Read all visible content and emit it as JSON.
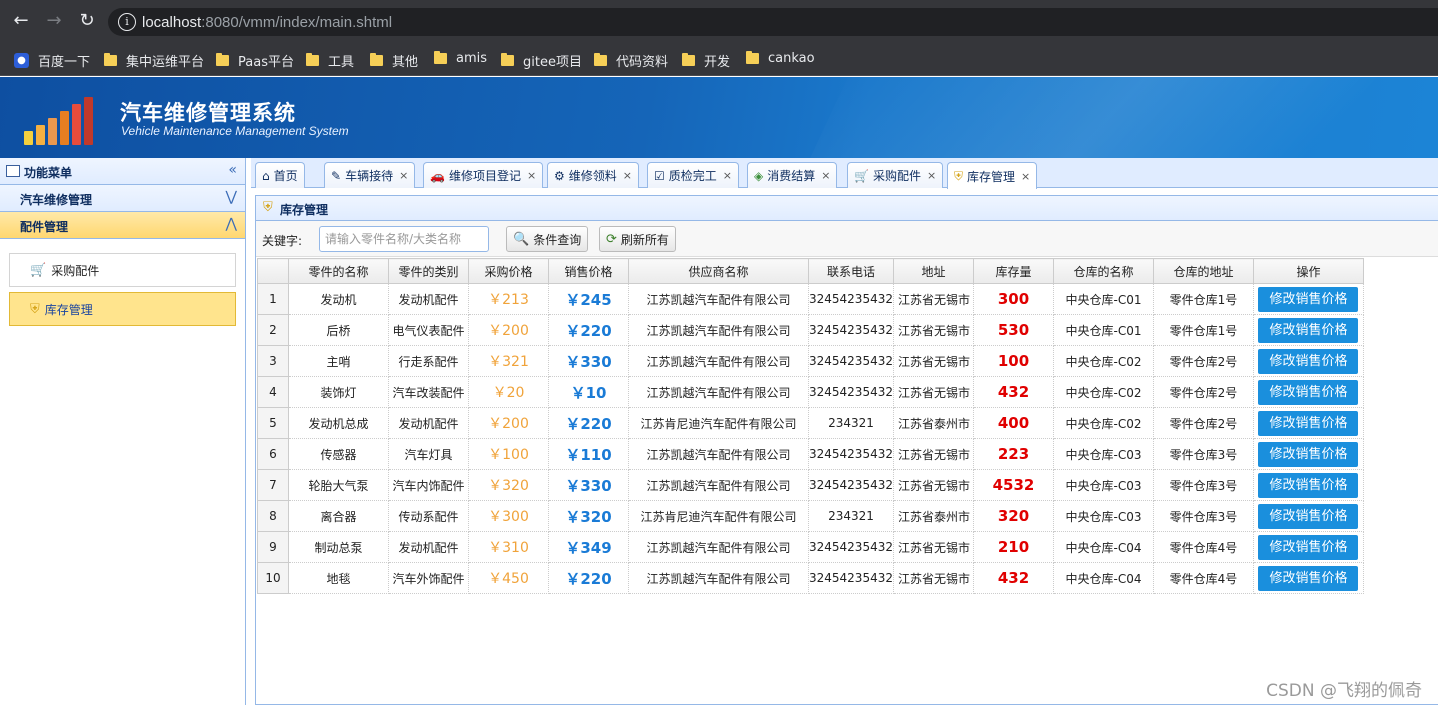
{
  "browser": {
    "url_host": "localhost",
    "url_rest": ":8080/vmm/index/main.shtml",
    "bookmarks": [
      {
        "label": "百度一下",
        "icon": "baidu-icon"
      },
      {
        "label": "集中运维平台",
        "icon": "folder-icon"
      },
      {
        "label": "Paas平台",
        "icon": "folder-icon"
      },
      {
        "label": "工具",
        "icon": "folder-icon"
      },
      {
        "label": "其他",
        "icon": "folder-icon"
      },
      {
        "label": "amis",
        "icon": "folder-icon"
      },
      {
        "label": "gitee项目",
        "icon": "folder-icon"
      },
      {
        "label": "代码资料",
        "icon": "folder-icon"
      },
      {
        "label": "开发",
        "icon": "folder-icon"
      },
      {
        "label": "cankao",
        "icon": "folder-icon"
      }
    ]
  },
  "app": {
    "title": "汽车维修管理系统",
    "subtitle": "Vehicle Maintenance Management System"
  },
  "menu": {
    "title": "功能菜单",
    "sections": [
      {
        "label": "汽车维修管理"
      },
      {
        "label": "配件管理"
      }
    ],
    "items": [
      {
        "label": "采购配件",
        "icon": "cart-icon"
      },
      {
        "label": "库存管理",
        "icon": "shield-icon"
      }
    ]
  },
  "tabs": [
    {
      "label": "首页",
      "icon": "home-icon"
    },
    {
      "label": "车辆接待",
      "icon": "form-icon"
    },
    {
      "label": "维修项目登记",
      "icon": "car-icon"
    },
    {
      "label": "维修领料",
      "icon": "parts-icon"
    },
    {
      "label": "质检完工",
      "icon": "check-icon"
    },
    {
      "label": "消费结算",
      "icon": "money-icon"
    },
    {
      "label": "采购配件",
      "icon": "cart-icon"
    },
    {
      "label": "库存管理",
      "icon": "shield-icon"
    }
  ],
  "content": {
    "title": "库存管理",
    "keyword_label": "关键字:",
    "keyword_placeholder": "请输入零件名称/大类名称",
    "search_button": "条件查询",
    "refresh_button": "刷新所有"
  },
  "grid": {
    "columns": [
      "零件的名称",
      "零件的类别",
      "采购价格",
      "销售价格",
      "供应商名称",
      "联系电话",
      "地址",
      "库存量",
      "仓库的名称",
      "仓库的地址",
      "操作"
    ],
    "action_label": "修改销售价格",
    "rows": [
      {
        "no": "1",
        "name": "发动机",
        "category": "发动机配件",
        "purchase": "￥213",
        "sale": "￥245",
        "supplier": "江苏凯越汽车配件有限公司",
        "phone": "32454235432",
        "address": "江苏省无锡市",
        "stock": "300",
        "warehouse": "中央仓库-C01",
        "wh_addr": "零件仓库1号"
      },
      {
        "no": "2",
        "name": "后桥",
        "category": "电气仪表配件",
        "purchase": "￥200",
        "sale": "￥220",
        "supplier": "江苏凯越汽车配件有限公司",
        "phone": "32454235432",
        "address": "江苏省无锡市",
        "stock": "530",
        "warehouse": "中央仓库-C01",
        "wh_addr": "零件仓库1号"
      },
      {
        "no": "3",
        "name": "主哨",
        "category": "行走系配件",
        "purchase": "￥321",
        "sale": "￥330",
        "supplier": "江苏凯越汽车配件有限公司",
        "phone": "32454235432",
        "address": "江苏省无锡市",
        "stock": "100",
        "warehouse": "中央仓库-C02",
        "wh_addr": "零件仓库2号"
      },
      {
        "no": "4",
        "name": "装饰灯",
        "category": "汽车改装配件",
        "purchase": "￥20",
        "sale": "￥10",
        "supplier": "江苏凯越汽车配件有限公司",
        "phone": "32454235432",
        "address": "江苏省无锡市",
        "stock": "432",
        "warehouse": "中央仓库-C02",
        "wh_addr": "零件仓库2号"
      },
      {
        "no": "5",
        "name": "发动机总成",
        "category": "发动机配件",
        "purchase": "￥200",
        "sale": "￥220",
        "supplier": "江苏肯尼迪汽车配件有限公司",
        "phone": "234321",
        "address": "江苏省泰州市",
        "stock": "400",
        "warehouse": "中央仓库-C02",
        "wh_addr": "零件仓库2号"
      },
      {
        "no": "6",
        "name": "传感器",
        "category": "汽车灯具",
        "purchase": "￥100",
        "sale": "￥110",
        "supplier": "江苏凯越汽车配件有限公司",
        "phone": "32454235432",
        "address": "江苏省无锡市",
        "stock": "223",
        "warehouse": "中央仓库-C03",
        "wh_addr": "零件仓库3号"
      },
      {
        "no": "7",
        "name": "轮胎大气泵",
        "category": "汽车内饰配件",
        "purchase": "￥320",
        "sale": "￥330",
        "supplier": "江苏凯越汽车配件有限公司",
        "phone": "32454235432",
        "address": "江苏省无锡市",
        "stock": "4532",
        "warehouse": "中央仓库-C03",
        "wh_addr": "零件仓库3号"
      },
      {
        "no": "8",
        "name": "离合器",
        "category": "传动系配件",
        "purchase": "￥300",
        "sale": "￥320",
        "supplier": "江苏肯尼迪汽车配件有限公司",
        "phone": "234321",
        "address": "江苏省泰州市",
        "stock": "320",
        "warehouse": "中央仓库-C03",
        "wh_addr": "零件仓库3号"
      },
      {
        "no": "9",
        "name": "制动总泵",
        "category": "发动机配件",
        "purchase": "￥310",
        "sale": "￥349",
        "supplier": "江苏凯越汽车配件有限公司",
        "phone": "32454235432",
        "address": "江苏省无锡市",
        "stock": "210",
        "warehouse": "中央仓库-C04",
        "wh_addr": "零件仓库4号"
      },
      {
        "no": "10",
        "name": "地毯",
        "category": "汽车外饰配件",
        "purchase": "￥450",
        "sale": "￥220",
        "supplier": "江苏凯越汽车配件有限公司",
        "phone": "32454235432",
        "address": "江苏省无锡市",
        "stock": "432",
        "warehouse": "中央仓库-C04",
        "wh_addr": "零件仓库4号"
      }
    ]
  },
  "watermark": "CSDN @飞翔的佩奇",
  "colors": {
    "header_blue": "#1565b8",
    "purchase_price": "#f0a33a",
    "sale_price": "#1a7bd6",
    "stock": "#e00000",
    "action_button": "#1a8fdd",
    "menu_selected": "#ffe48d"
  }
}
